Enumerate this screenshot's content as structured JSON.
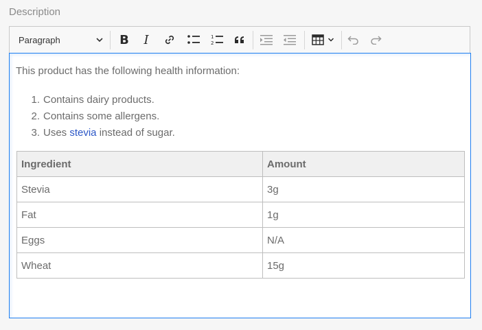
{
  "field": {
    "label": "Description"
  },
  "toolbar": {
    "block_format": "Paragraph",
    "icons": [
      "bold-icon",
      "italic-icon",
      "link-icon",
      "bulleted-list-icon",
      "numbered-list-icon",
      "blockquote-icon",
      "indent-icon",
      "outdent-icon",
      "table-icon",
      "undo-icon",
      "redo-icon"
    ],
    "bold_glyph": "B",
    "italic_glyph": "I"
  },
  "content": {
    "intro": "This product has the following health information:",
    "list": [
      {
        "num": "1.",
        "text": "Contains dairy products."
      },
      {
        "num": "2.",
        "text": "Contains some allergens."
      },
      {
        "num": "3.",
        "before": "Uses ",
        "link": "stevia",
        "after": " instead of sugar."
      }
    ],
    "table": {
      "headers": [
        "Ingredient",
        "Amount"
      ],
      "rows": [
        [
          "Stevia",
          "3g"
        ],
        [
          "Fat",
          "1g"
        ],
        [
          "Eggs",
          "N/A"
        ],
        [
          "Wheat",
          "15g"
        ]
      ]
    }
  },
  "colors": {
    "focus_border": "#1f7ff0",
    "link": "#2c57c7"
  }
}
